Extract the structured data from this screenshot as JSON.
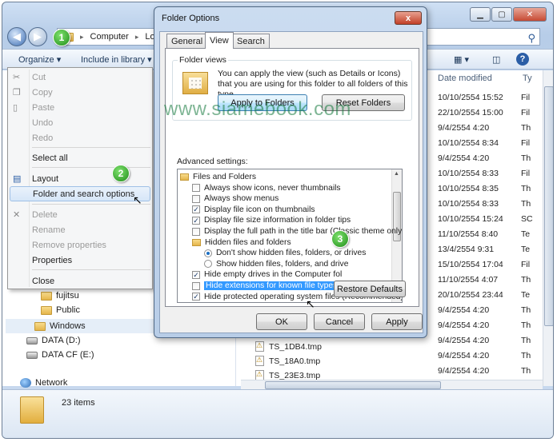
{
  "explorer": {
    "address": [
      "Computer",
      "Loca"
    ],
    "toolbar": {
      "organize": "Organize ▾",
      "include": "Include in library ▾"
    },
    "left_nav": [
      {
        "label": "fujitsu",
        "icon": "folder"
      },
      {
        "label": "Public",
        "icon": "folder"
      },
      {
        "label": "Windows",
        "icon": "folder"
      },
      {
        "label": "DATA (D:)",
        "icon": "drive"
      },
      {
        "label": "DATA CF (E:)",
        "icon": "drive"
      },
      {
        "label": "Network",
        "icon": "network"
      }
    ],
    "columns": {
      "date": "Date modified",
      "type": "Ty"
    },
    "dates": [
      "10/10/2554 15:52",
      "22/10/2554 15:00",
      "9/4/2554 4:20",
      "10/10/2554 8:34",
      "9/4/2554 4:20",
      "10/10/2554 8:33",
      "10/10/2554 8:35",
      "10/10/2554 8:33",
      "10/10/2554 15:24",
      "11/10/2554 8:40",
      "13/4/2554 9:31",
      "15/10/2554 17:04",
      "11/10/2554 4:07",
      "20/10/2554 23:44",
      "9/4/2554 4:20",
      "9/4/2554 4:20",
      "9/4/2554 4:20",
      "9/4/2554 4:20",
      "9/4/2554 4:20",
      "9/4/2554 4:20",
      "9/4/2554 4:20"
    ],
    "types": [
      "Fil",
      "Fil",
      "Th",
      "Fil",
      "Th",
      "Fil",
      "Th",
      "Th",
      "SC",
      "Te",
      "Te",
      "Fil",
      "Th",
      "Te",
      "Th",
      "Th",
      "Th",
      "Th",
      "Th",
      "Th",
      "Th"
    ],
    "files": [
      "TS_1DB4.tmp",
      "TS_18A0.tmp",
      "TS_23E3.tmp"
    ],
    "status": "23 items"
  },
  "menu": {
    "items": [
      {
        "label": "Cut",
        "disabled": true,
        "icon": "✂"
      },
      {
        "label": "Copy",
        "disabled": true,
        "icon": "❐"
      },
      {
        "label": "Paste",
        "disabled": true,
        "icon": "📋"
      },
      {
        "label": "Undo",
        "disabled": true
      },
      {
        "label": "Redo",
        "disabled": true
      },
      {
        "label": "Select all",
        "disabled": false
      },
      {
        "label": "Layout",
        "disabled": false,
        "icon": "▤"
      },
      {
        "label": "Folder and search options",
        "disabled": false,
        "hover": true
      },
      {
        "label": "Delete",
        "disabled": true,
        "icon": "✕"
      },
      {
        "label": "Rename",
        "disabled": true
      },
      {
        "label": "Remove properties",
        "disabled": true
      },
      {
        "label": "Properties",
        "disabled": false
      },
      {
        "label": "Close",
        "disabled": false
      }
    ]
  },
  "dialog": {
    "title": "Folder Options",
    "close": "x",
    "tabs": [
      "General",
      "View",
      "Search"
    ],
    "folder_views": {
      "label": "Folder views",
      "text": "You can apply the view (such as Details or Icons) that you are using for this folder to all folders of this type.",
      "apply": "Apply to Folders",
      "reset": "Reset Folders"
    },
    "advanced_label": "Advanced settings:",
    "tree": [
      {
        "label": "Files and Folders",
        "kind": "folder",
        "indent": 0
      },
      {
        "label": "Always show icons, never thumbnails",
        "kind": "check",
        "checked": false,
        "indent": 1
      },
      {
        "label": "Always show menus",
        "kind": "check",
        "checked": false,
        "indent": 1
      },
      {
        "label": "Display file icon on thumbnails",
        "kind": "check",
        "checked": true,
        "indent": 1
      },
      {
        "label": "Display file size information in folder tips",
        "kind": "check",
        "checked": true,
        "indent": 1
      },
      {
        "label": "Display the full path in the title bar (Classic theme only)",
        "kind": "check",
        "checked": false,
        "indent": 1
      },
      {
        "label": "Hidden files and folders",
        "kind": "folder",
        "indent": 1
      },
      {
        "label": "Don't show hidden files, folders, or drives",
        "kind": "radio",
        "checked": true,
        "indent": 2
      },
      {
        "label": "Show hidden files, folders, and drive",
        "kind": "radio",
        "checked": false,
        "indent": 2
      },
      {
        "label": "Hide empty drives in the Computer fol",
        "kind": "check",
        "checked": true,
        "indent": 1
      },
      {
        "label": "Hide extensions for known file types",
        "kind": "check",
        "checked": false,
        "indent": 1,
        "selected": true
      },
      {
        "label": "Hide protected operating system files (Recommended)",
        "kind": "check",
        "checked": true,
        "indent": 1
      }
    ],
    "restore": "Restore Defaults",
    "ok": "OK",
    "cancel": "Cancel",
    "apply": "Apply"
  },
  "watermark": "www.siamebook.com",
  "badges": [
    "1",
    "2",
    "3"
  ]
}
